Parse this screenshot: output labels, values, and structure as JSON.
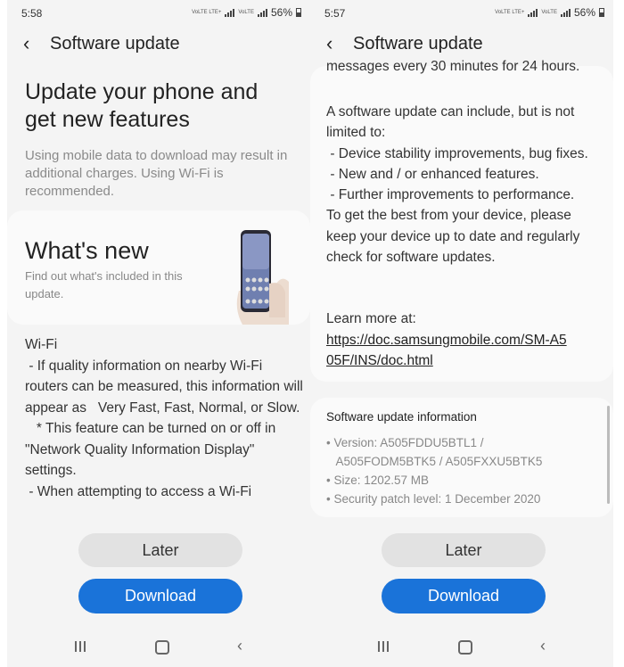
{
  "left": {
    "status": {
      "time": "5:58",
      "network": "VoLTE LTE+",
      "network2": "VoLTE",
      "battery": "56%"
    },
    "header": {
      "back_icon": "arrow-left-icon",
      "title": "Software update"
    },
    "hero_title": "Update your phone and get new features",
    "warning": "Using mobile data to download may result in additional charges. Using Wi-Fi is recommended.",
    "whats_new": {
      "title": "What's new",
      "subtitle": "Find out what's included in this update."
    },
    "notes": "Wi-Fi\n - If quality information on nearby Wi-Fi routers can be measured, this information will appear as   Very Fast, Fast, Normal, or Slow.\n   * This feature can be turned on or off in \"Network Quality Information Display\" settings.\n - When attempting to access a Wi-Fi",
    "buttons": {
      "later": "Later",
      "download": "Download"
    }
  },
  "right": {
    "status": {
      "time": "5:57",
      "network": "VoLTE LTE+",
      "network2": "VoLTE",
      "battery": "56%"
    },
    "header": {
      "back_icon": "arrow-left-icon",
      "title": "Software update"
    },
    "top_fragment": "messages every 30 minutes for 24 hours.",
    "body_text": "A software update can include, but is not limited to:\n - Device stability improvements, bug fixes.\n - New and / or enhanced features.\n - Further improvements to performance.\nTo get the best from your device, please keep your device up to date and regularly check for software updates.",
    "learn_more": "Learn more at:",
    "link": "https://doc.samsungmobile.com/SM-A505F/INS/doc.html",
    "info": {
      "title": "Software update information",
      "items": "• Version: A505FDDU5BTL1 /\n   A505FODM5BTK5 / A505FXXU5BTK5\n• Size: 1202.57 MB\n• Security patch level: 1 December 2020"
    },
    "buttons": {
      "later": "Later",
      "download": "Download"
    }
  },
  "colors": {
    "accent": "#1a73d9",
    "background": "#f4f4f4",
    "card": "#fafafa"
  }
}
